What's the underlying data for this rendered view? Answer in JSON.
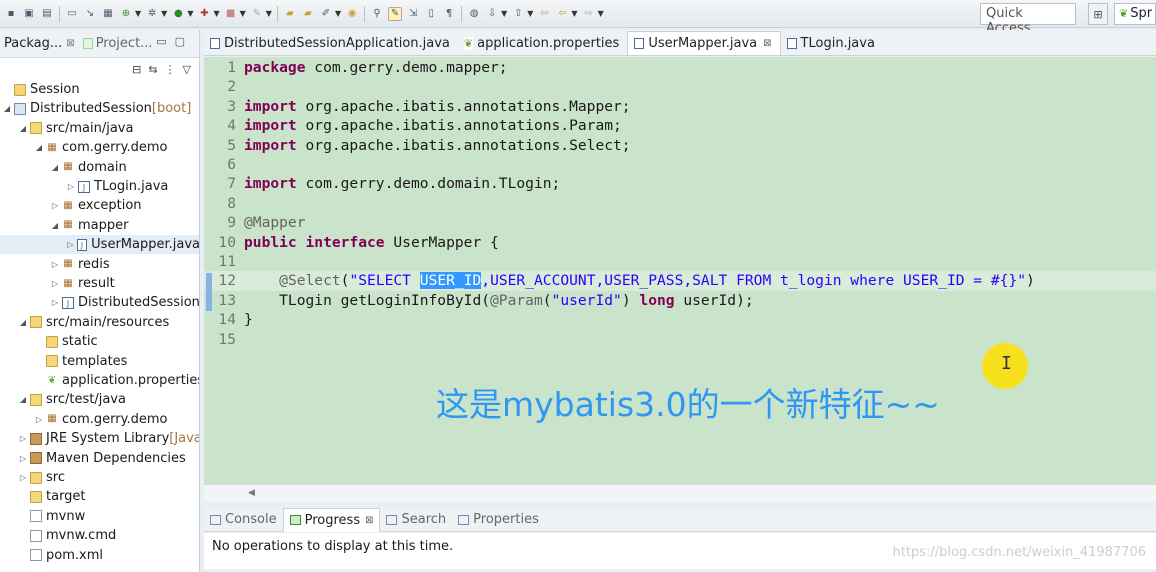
{
  "toolbar": {
    "quick_access_placeholder": "Quick Access",
    "perspective_label": "Spr"
  },
  "explorer": {
    "tabs": [
      {
        "label": "Packag...",
        "close": "⊠"
      },
      {
        "label": "Project..."
      }
    ],
    "tree": [
      {
        "label": "Session",
        "indent": 0,
        "arrow": "",
        "icon": "folder"
      },
      {
        "label": "DistributedSession",
        "suffix": " [boot]",
        "indent": 0,
        "arrow": "◢",
        "icon": "project"
      },
      {
        "label": "src/main/java",
        "indent": 1,
        "arrow": "◢",
        "icon": "src"
      },
      {
        "label": "com.gerry.demo",
        "indent": 2,
        "arrow": "◢",
        "icon": "pkg"
      },
      {
        "label": "domain",
        "indent": 3,
        "arrow": "◢",
        "icon": "pkg"
      },
      {
        "label": "TLogin.java",
        "indent": 4,
        "arrow": "▷",
        "icon": "java"
      },
      {
        "label": "exception",
        "indent": 3,
        "arrow": "▷",
        "icon": "pkg"
      },
      {
        "label": "mapper",
        "indent": 3,
        "arrow": "◢",
        "icon": "pkg"
      },
      {
        "label": "UserMapper.java",
        "indent": 4,
        "arrow": "▷",
        "icon": "java",
        "selected": true
      },
      {
        "label": "redis",
        "indent": 3,
        "arrow": "▷",
        "icon": "pkg"
      },
      {
        "label": "result",
        "indent": 3,
        "arrow": "▷",
        "icon": "pkg"
      },
      {
        "label": "DistributedSessionA",
        "indent": 3,
        "arrow": "▷",
        "icon": "java"
      },
      {
        "label": "src/main/resources",
        "indent": 1,
        "arrow": "◢",
        "icon": "src"
      },
      {
        "label": "static",
        "indent": 2,
        "arrow": "",
        "icon": "folder"
      },
      {
        "label": "templates",
        "indent": 2,
        "arrow": "",
        "icon": "folder"
      },
      {
        "label": "application.properties",
        "indent": 2,
        "arrow": "",
        "icon": "leaf"
      },
      {
        "label": "src/test/java",
        "indent": 1,
        "arrow": "◢",
        "icon": "src"
      },
      {
        "label": "com.gerry.demo",
        "indent": 2,
        "arrow": "▷",
        "icon": "pkg"
      },
      {
        "label": "JRE System Library",
        "suffix": " [JavaS",
        "indent": 1,
        "arrow": "▷",
        "icon": "jar"
      },
      {
        "label": "Maven Dependencies",
        "indent": 1,
        "arrow": "▷",
        "icon": "jar"
      },
      {
        "label": "src",
        "indent": 1,
        "arrow": "▷",
        "icon": "folder"
      },
      {
        "label": "target",
        "indent": 1,
        "arrow": "",
        "icon": "folder"
      },
      {
        "label": "mvnw",
        "indent": 1,
        "arrow": "",
        "icon": "file"
      },
      {
        "label": "mvnw.cmd",
        "indent": 1,
        "arrow": "",
        "icon": "file"
      },
      {
        "label": "pom.xml",
        "indent": 1,
        "arrow": "",
        "icon": "file"
      }
    ]
  },
  "editor": {
    "tabs": [
      {
        "label": "DistributedSessionApplication.java",
        "icon": "java"
      },
      {
        "label": "application.properties",
        "icon": "leaf"
      },
      {
        "label": "UserMapper.java",
        "icon": "java",
        "active": true,
        "close": "⊠"
      },
      {
        "label": "TLogin.java",
        "icon": "java"
      }
    ],
    "lines": [
      [
        [
          "kw",
          "package"
        ],
        [
          "t",
          " com.gerry.demo.mapper;"
        ]
      ],
      [],
      [
        [
          "kw",
          "import"
        ],
        [
          "t",
          " org.apache.ibatis.annotations.Mapper;"
        ]
      ],
      [
        [
          "kw",
          "import"
        ],
        [
          "t",
          " org.apache.ibatis.annotations.Param;"
        ]
      ],
      [
        [
          "kw",
          "import"
        ],
        [
          "t",
          " org.apache.ibatis.annotations.Select;"
        ]
      ],
      [],
      [
        [
          "kw",
          "import"
        ],
        [
          "t",
          " com.gerry.demo.domain.TLogin;"
        ]
      ],
      [],
      [
        [
          "ann",
          "@Mapper"
        ]
      ],
      [
        [
          "kw",
          "public"
        ],
        [
          "t",
          " "
        ],
        [
          "kw",
          "interface"
        ],
        [
          "t",
          " UserMapper {"
        ]
      ],
      [],
      [
        [
          "t",
          "    "
        ],
        [
          "ann",
          "@Select"
        ],
        [
          "t",
          "("
        ],
        [
          "str",
          "\"SELECT "
        ],
        [
          "sel",
          "USER_ID"
        ],
        [
          "str",
          ",USER_ACCOUNT,USER_PASS,SALT FROM t_login where USER_ID = #{}\""
        ],
        [
          "t",
          ")"
        ]
      ],
      [
        [
          "t",
          "    TLogin getLoginInfoById("
        ],
        [
          "ann",
          "@Param"
        ],
        [
          "t",
          "("
        ],
        [
          "str",
          "\"userId\""
        ],
        [
          "t",
          ") "
        ],
        [
          "kw",
          "long"
        ],
        [
          "t",
          " userId);"
        ]
      ],
      [
        [
          "t",
          "}"
        ]
      ],
      []
    ],
    "current_line": 12,
    "caption": "这是mybatis3.0的一个新特征~~"
  },
  "bottom": {
    "tabs": [
      {
        "label": "Console"
      },
      {
        "label": "Progress",
        "active": true,
        "close": "⊠"
      },
      {
        "label": "Search"
      },
      {
        "label": "Properties"
      }
    ],
    "message": "No operations to display at this time."
  },
  "watermark": "https://blog.csdn.net/weixin_41987706",
  "colors": {
    "editor_bg": "#c9e4cb",
    "keyword": "#7f0055",
    "string": "#2a00ff",
    "annotation": "#646464",
    "selection": "#3399ff",
    "caption": "#2f97f2"
  }
}
